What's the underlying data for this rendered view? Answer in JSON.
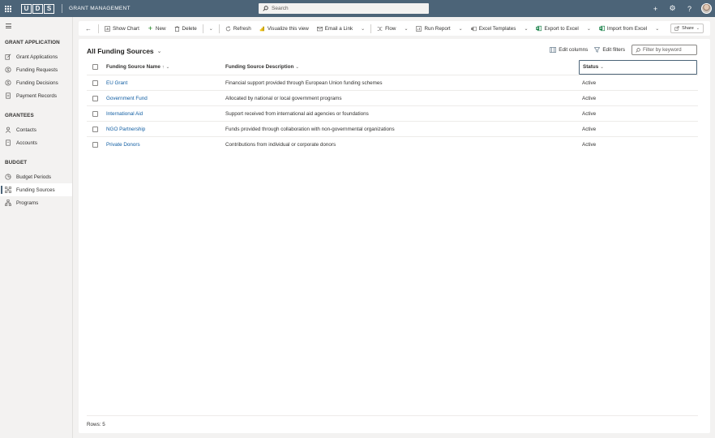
{
  "topbar": {
    "logo_letters": [
      "U",
      "D",
      "S"
    ],
    "app_title": "GRANT MANAGEMENT",
    "search_placeholder": "Search",
    "icons": [
      "plus-icon",
      "gear-icon",
      "help-icon",
      "avatar"
    ],
    "plus_glyph": "+",
    "gear_glyph": "⚙",
    "help_glyph": "?"
  },
  "sidebar": {
    "groups": [
      {
        "title": "GRANT APPLICATION",
        "items": [
          {
            "label": "Grant Applications",
            "icon": "pencil-icon"
          },
          {
            "label": "Funding Requests",
            "icon": "coin-icon"
          },
          {
            "label": "Funding Decisions",
            "icon": "coin-icon"
          },
          {
            "label": "Payment Records",
            "icon": "document-icon"
          }
        ]
      },
      {
        "title": "GRANTEES",
        "items": [
          {
            "label": "Contacts",
            "icon": "person-icon"
          },
          {
            "label": "Accounts",
            "icon": "document-icon"
          }
        ]
      },
      {
        "title": "BUDGET",
        "items": [
          {
            "label": "Budget Periods",
            "icon": "chart-icon"
          },
          {
            "label": "Funding Sources",
            "icon": "network-icon",
            "active": true
          },
          {
            "label": "Programs",
            "icon": "hierarchy-icon"
          }
        ]
      }
    ]
  },
  "commandbar": {
    "back_glyph": "←",
    "show_chart": "Show Chart",
    "new": "New",
    "delete": "Delete",
    "refresh": "Refresh",
    "visualize": "Visualize this view",
    "email_link": "Email a Link",
    "flow": "Flow",
    "run_report": "Run Report",
    "excel_templates": "Excel Templates",
    "export_excel": "Export to Excel",
    "import_excel": "Import from Excel",
    "share": "Share",
    "chevron_glyph": "⌄"
  },
  "view": {
    "title": "All Funding Sources",
    "edit_columns": "Edit columns",
    "edit_filters": "Edit filters",
    "filter_placeholder": "Filter by keyword"
  },
  "grid": {
    "headers": {
      "name": "Funding Source Name",
      "name_sort": "↑",
      "description": "Funding Source Description",
      "status": "Status"
    },
    "rows": [
      {
        "name": "EU Grant",
        "description": "Financial support provided through European Union funding schemes",
        "status": "Active"
      },
      {
        "name": "Government Fund",
        "description": "Allocated by national or local government programs",
        "status": "Active"
      },
      {
        "name": "International Aid",
        "description": "Support received from international aid agencies or foundations",
        "status": "Active"
      },
      {
        "name": "NGO Partnership",
        "description": "Funds provided through collaboration with non-governmental organizations",
        "status": "Active"
      },
      {
        "name": "Private Donors",
        "description": "Contributions from individual or corporate donors",
        "status": "Active"
      }
    ],
    "footer": "Rows: 5"
  },
  "colors": {
    "brand": "#4c6478",
    "link": "#115ea3"
  }
}
